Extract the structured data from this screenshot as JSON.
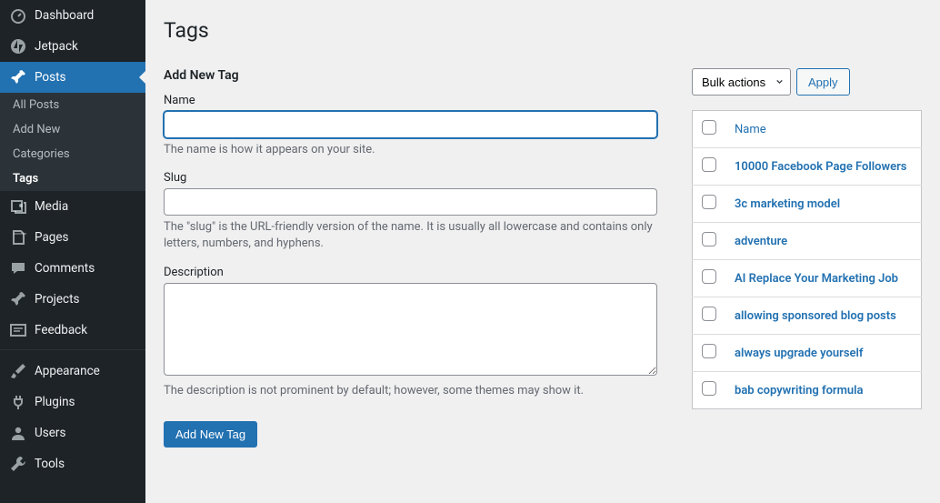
{
  "sidebar": {
    "items": [
      {
        "label": "Dashboard",
        "icon": "dashboard"
      },
      {
        "label": "Jetpack",
        "icon": "jetpack"
      },
      {
        "label": "Posts",
        "icon": "pin",
        "active": true,
        "submenu": [
          "All Posts",
          "Add New",
          "Categories",
          "Tags"
        ],
        "submenu_current": 3
      },
      {
        "label": "Media",
        "icon": "media"
      },
      {
        "label": "Pages",
        "icon": "pages"
      },
      {
        "label": "Comments",
        "icon": "comments"
      },
      {
        "label": "Projects",
        "icon": "pin"
      },
      {
        "label": "Feedback",
        "icon": "feedback"
      }
    ],
    "items2": [
      {
        "label": "Appearance",
        "icon": "brush"
      },
      {
        "label": "Plugins",
        "icon": "plug"
      },
      {
        "label": "Users",
        "icon": "user"
      },
      {
        "label": "Tools",
        "icon": "wrench"
      }
    ]
  },
  "page": {
    "title": "Tags"
  },
  "form": {
    "heading": "Add New Tag",
    "name_label": "Name",
    "name_value": "",
    "name_help": "The name is how it appears on your site.",
    "slug_label": "Slug",
    "slug_value": "",
    "slug_help": "The \"slug\" is the URL-friendly version of the name. It is usually all lowercase and contains only letters, numbers, and hyphens.",
    "desc_label": "Description",
    "desc_value": "",
    "desc_help": "The description is not prominent by default; however, some themes may show it.",
    "submit_label": "Add New Tag"
  },
  "table": {
    "bulk_label": "Bulk actions",
    "apply_label": "Apply",
    "name_col": "Name",
    "rows": [
      "10000 Facebook Page Followers",
      "3c marketing model",
      "adventure",
      "AI Replace Your Marketing Job",
      "allowing sponsored blog posts",
      "always upgrade yourself",
      "bab copywriting formula"
    ]
  }
}
